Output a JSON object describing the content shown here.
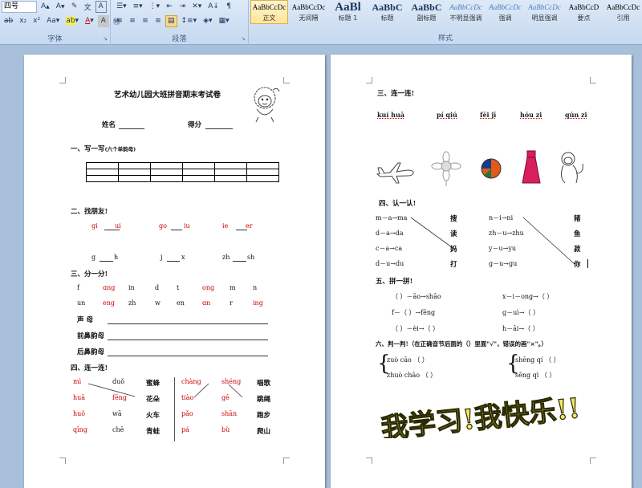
{
  "ribbon": {
    "font_size": "四号",
    "font_group_label": "字体",
    "paragraph_group_label": "段落",
    "styles_group_label": "样式",
    "styles": [
      {
        "preview": "AaBbCcDc",
        "name": "正文"
      },
      {
        "preview": "AaBbCcDc",
        "name": "无间隔"
      },
      {
        "preview": "AaBl",
        "name": "标题 1"
      },
      {
        "preview": "AaBbC",
        "name": "标题"
      },
      {
        "preview": "AaBbC",
        "name": "副标题"
      },
      {
        "preview": "AaBbCcDc",
        "name": "不明显强调"
      },
      {
        "preview": "AaBbCcDc",
        "name": "强调"
      },
      {
        "preview": "AaBbCcDc",
        "name": "明显强调"
      },
      {
        "preview": "AaBbCcD",
        "name": "要点"
      },
      {
        "preview": "AaBbCcDc",
        "name": "引用"
      }
    ]
  },
  "page1": {
    "title": "艺术幼儿园大班拼音期末考试卷",
    "name_label": "姓名",
    "score_label": "得分",
    "s1": "一、写一写",
    "s1_note": "(六个单韵母)",
    "s2": "二、找朋友!",
    "s2_row1": [
      "gi",
      "ui",
      "go",
      "iu",
      "ie",
      "er"
    ],
    "s2_row2": [
      "g",
      "h",
      "j",
      "x",
      "zh",
      "sh"
    ],
    "s3": "三、分一分!",
    "s3_row1": [
      "f",
      "ɑng",
      "in",
      "d",
      "t",
      "ong",
      "m",
      "n"
    ],
    "s3_row2": [
      "un",
      "eng",
      "zh",
      "w",
      "en",
      "ɑn",
      "r",
      "ing"
    ],
    "s3_lines": [
      "声    母",
      "前鼻韵母",
      "后鼻韵母"
    ],
    "s4": "四、连一连!",
    "s4_left_py": [
      "mì",
      "huā",
      "huǒ",
      "qīng"
    ],
    "s4_mid_py": [
      "duǒ",
      "fēng",
      "wā",
      "chē"
    ],
    "s4_words_l": [
      "蜜蜂",
      "花朵",
      "火车",
      "青蛙"
    ],
    "s4_right_py1": [
      "chàng",
      "tiào",
      "pǎo",
      "pá"
    ],
    "s4_right_py2": [
      "shéng",
      "gē",
      "shān",
      "bù"
    ],
    "s4_words_r": [
      "唱歌",
      "跳绳",
      "跑步",
      "爬山"
    ]
  },
  "page2": {
    "s3": "三、连一连!",
    "s3_py": [
      "kuí huā",
      "pí qiú",
      "fēi jī",
      "hóu zi",
      "qún zi"
    ],
    "s4": "四、认一认!",
    "s4_left": [
      "m－a→ma",
      "d－a→da",
      "c－a→ca",
      "d－u→du"
    ],
    "s4_left_cn": [
      "搜",
      "读",
      "妈",
      "打"
    ],
    "s4_right": [
      "n－i→ni",
      "zh－u→zhu",
      "y－u→yu",
      "g－u→gu"
    ],
    "s4_right_cn": [
      "猪",
      "鱼",
      "菽",
      "你"
    ],
    "s5": "五、拼一拼!",
    "s5_items": [
      "（    ）－āo→shāo",
      "f－（  ）→fēng",
      "（  ）－èi→（  ）",
      "x－i－ong→（    ）",
      "g－uì→（    ）",
      "h－āi→（    ）"
    ],
    "s6": "六、判一判!（在正确音节后面的（）里面\"√\"，错误的画\"×\"。）",
    "s6_items": [
      "zuò  cāo  （    ）",
      "zhuò  chāo  （    ）",
      "shēng  qí  （    ）",
      "sēng  qì  （    ）"
    ],
    "art_text": "我学习!我快乐!!"
  },
  "colors": {
    "art_fill": "#f5e66a",
    "art_stroke": "#2a2a00",
    "accent": "#d6b14e"
  }
}
